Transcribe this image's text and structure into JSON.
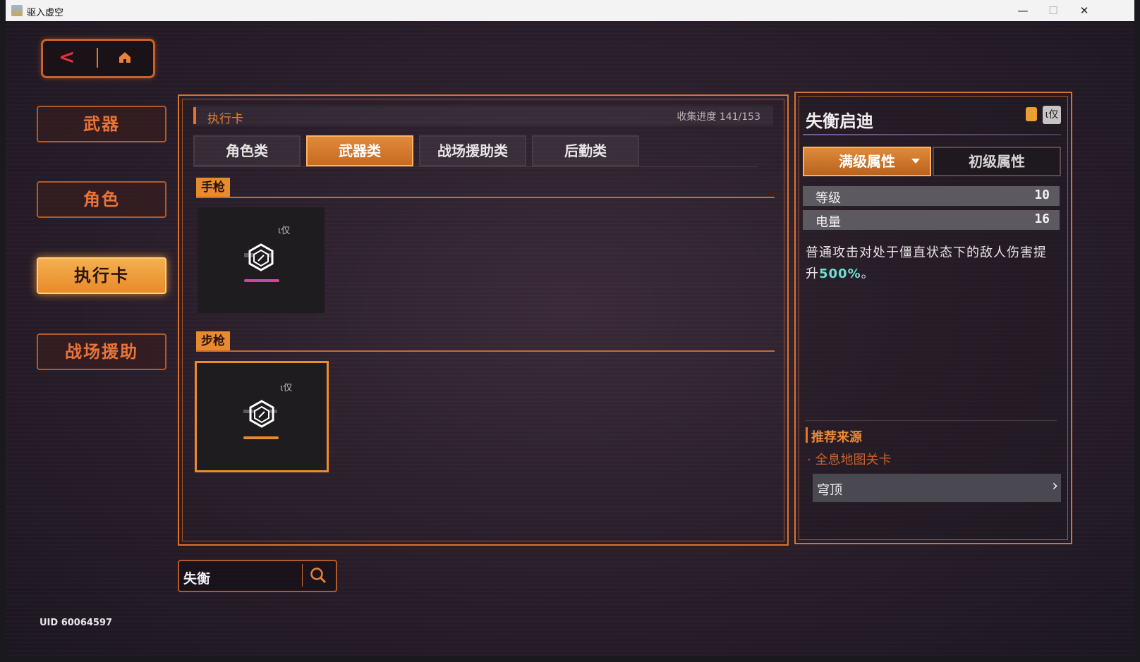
{
  "window": {
    "title": "驱入虚空",
    "minimize": "—",
    "maximize": "☐",
    "close": "✕"
  },
  "nav": {
    "back": "<"
  },
  "sidebar": {
    "items": [
      {
        "label": "武器"
      },
      {
        "label": "角色"
      },
      {
        "label": "执行卡",
        "active": true
      },
      {
        "label": "战场援助"
      }
    ]
  },
  "panel": {
    "title": "执行卡",
    "progress": "收集进度 141/153",
    "tabs": [
      {
        "label": "角色类"
      },
      {
        "label": "武器类",
        "active": true
      },
      {
        "label": "战场援助类"
      },
      {
        "label": "后勤类"
      }
    ],
    "sections": [
      {
        "label": "手枪",
        "cards": [
          {
            "tag": "ι仅",
            "glow": "#c84a9a",
            "selected": false
          }
        ]
      },
      {
        "label": "步枪",
        "cards": [
          {
            "tag": "ι仅",
            "glow": "#e88a2a",
            "selected": true
          }
        ]
      }
    ]
  },
  "detail": {
    "name": "失衡启迪",
    "badge": "ι仅",
    "tab_full": "满级属性",
    "tab_base": "初级属性",
    "stats": [
      {
        "label": "等级",
        "value": "10"
      },
      {
        "label": "电量",
        "value": "16"
      }
    ],
    "desc_pre": "普通攻击对处于僵直状态下的敌人伤害提升",
    "desc_hl": "500%",
    "desc_post": "。",
    "source_title": "推荐来源",
    "source_sub": "全息地图关卡",
    "source_item": "穹顶",
    "source_arrow": "›"
  },
  "search": {
    "value": "失衡"
  },
  "uid": "UID 60064597",
  "colors": {
    "accent": "#e8742a",
    "highlight": "#6fe0d4",
    "back": "#e6303a"
  }
}
